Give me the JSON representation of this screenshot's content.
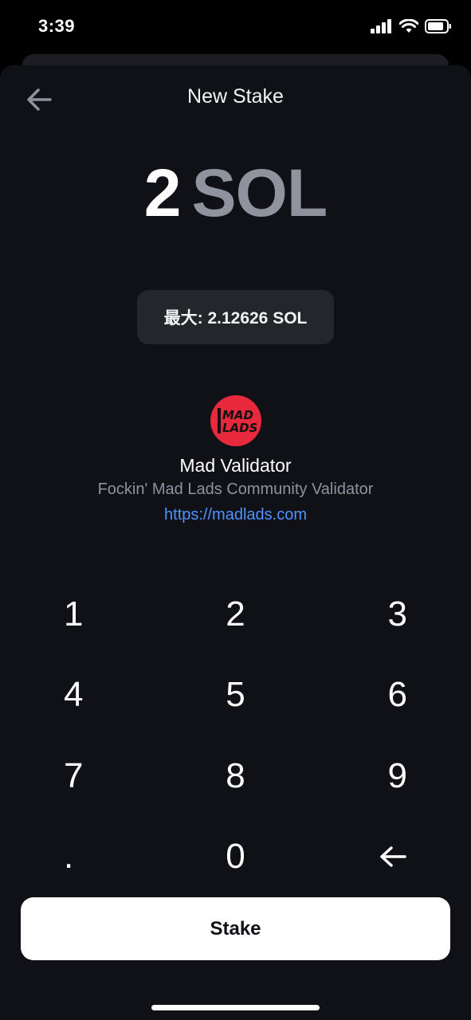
{
  "status_bar": {
    "time": "3:39"
  },
  "header": {
    "title": "New Stake",
    "back_icon": "arrow-left-icon"
  },
  "amount": {
    "value": "2",
    "unit": "SOL"
  },
  "max": {
    "label": "最大: 2.12626 SOL"
  },
  "validator": {
    "logo_text": "MAD LADS",
    "name": "Mad Validator",
    "description": "Fockin' Mad Lads Community Validator",
    "url": "https://madlads.com"
  },
  "keypad": {
    "keys": [
      "1",
      "2",
      "3",
      "4",
      "5",
      "6",
      "7",
      "8",
      "9",
      ".",
      "0"
    ],
    "backspace_icon": "arrow-left-icon"
  },
  "stake_button": {
    "label": "Stake"
  },
  "colors": {
    "background": "#101116",
    "muted": "#8e939e",
    "link": "#4c94ff",
    "logo": "#e8283d"
  }
}
